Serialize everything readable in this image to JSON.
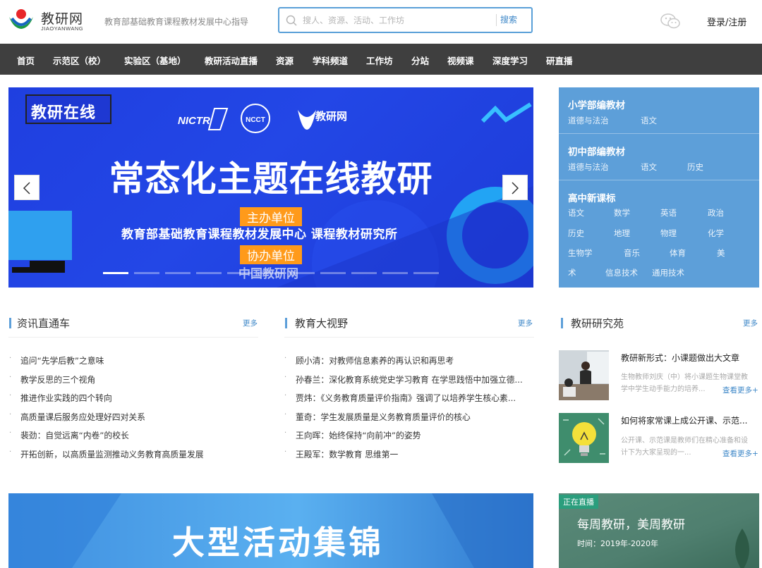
{
  "header": {
    "logo_text": "教研网",
    "logo_sub": "JIAOYANWANG",
    "tagline": "教育部基础教育课程教材发展中心指导",
    "search_placeholder": "搜人、资源、活动、工作坊",
    "search_button": "搜索",
    "login": "登录/注册"
  },
  "nav": [
    "首页",
    "示范区（校）",
    "实验区（基地）",
    "教研活动直播",
    "资源",
    "学科频道",
    "工作坊",
    "分站",
    "视频课",
    "深度学习",
    "研直播"
  ],
  "banner": {
    "badge": "教研在线",
    "brand": "教研网",
    "logo_nictr": "NICTR",
    "logo_ncct": "NCCT",
    "title": "常态化主题在线教研",
    "host_tag": "主办单位",
    "host": "教育部基础教育课程教材发展中心  课程教材研究所",
    "co_tag": "协办单位",
    "co": "中国教研网",
    "active_slide": 1,
    "slide_count": 11
  },
  "subjects": {
    "primary_title": "小学部编教材",
    "primary": [
      "道德与法治",
      "语文"
    ],
    "middle_title": "初中部编教材",
    "middle": [
      "道德与法治",
      "语文",
      "历史"
    ],
    "high_title": "高中新课标",
    "high": [
      "语文",
      "数学",
      "英语",
      "政治",
      "历史",
      "地理",
      "物理",
      "化学",
      "生物学",
      "音乐",
      "体育",
      "美",
      "术",
      "信息技术",
      "通用技术"
    ]
  },
  "news": {
    "title": "资讯直通车",
    "more": "更多",
    "items": [
      "追问“先学后教”之意味",
      "教学反思的三个视角",
      "推进作业实践的四个转向",
      "高质量课后服务应处理好四对关系",
      "裴劲：自觉远离“内卷”的校长",
      "开拓创新，以高质量监测推动义务教育高质量发展"
    ]
  },
  "vision": {
    "title": "教育大视野",
    "more": "更多",
    "items": [
      "顾小清：对教师信息素养的再认识和再思考",
      "孙春兰：深化教育系统党史学习教育 在学思践悟中加强立德...",
      "贾炜：《义务教育质量评价指南》强调了以培养学生核心素...",
      "董奇：学生发展质量是义务教育质量评价的核心",
      "王向晖：始终保持“向前冲”的姿势",
      "王殿军：数学教育 思维第一"
    ]
  },
  "research": {
    "title": "教研研究苑",
    "more": "更多",
    "cards": [
      {
        "title": "教研新形式：小课题做出大文章",
        "desc1": "生物教师刘庆（中）将小课题生物课堂教",
        "desc2": "学中学生动手能力的培养...",
        "more": "查看更多+"
      },
      {
        "title": "如何将家常课上成公开课、示范...",
        "desc1": "公开课、示范课是教师们在精心准备和设",
        "desc2": "计下为大家呈现的一...",
        "more": "查看更多+"
      }
    ]
  },
  "bottom": {
    "title": "大型活动集锦",
    "live_badge": "正在直播",
    "live_title": "每周教研，美周教研",
    "live_time": "时间：2019年-2020年"
  },
  "colors": {
    "nav_bg": "#3f3f3f",
    "accent": "#5d9fd9",
    "link": "#3f88c8",
    "tag_orange": "#ff9a1a"
  }
}
